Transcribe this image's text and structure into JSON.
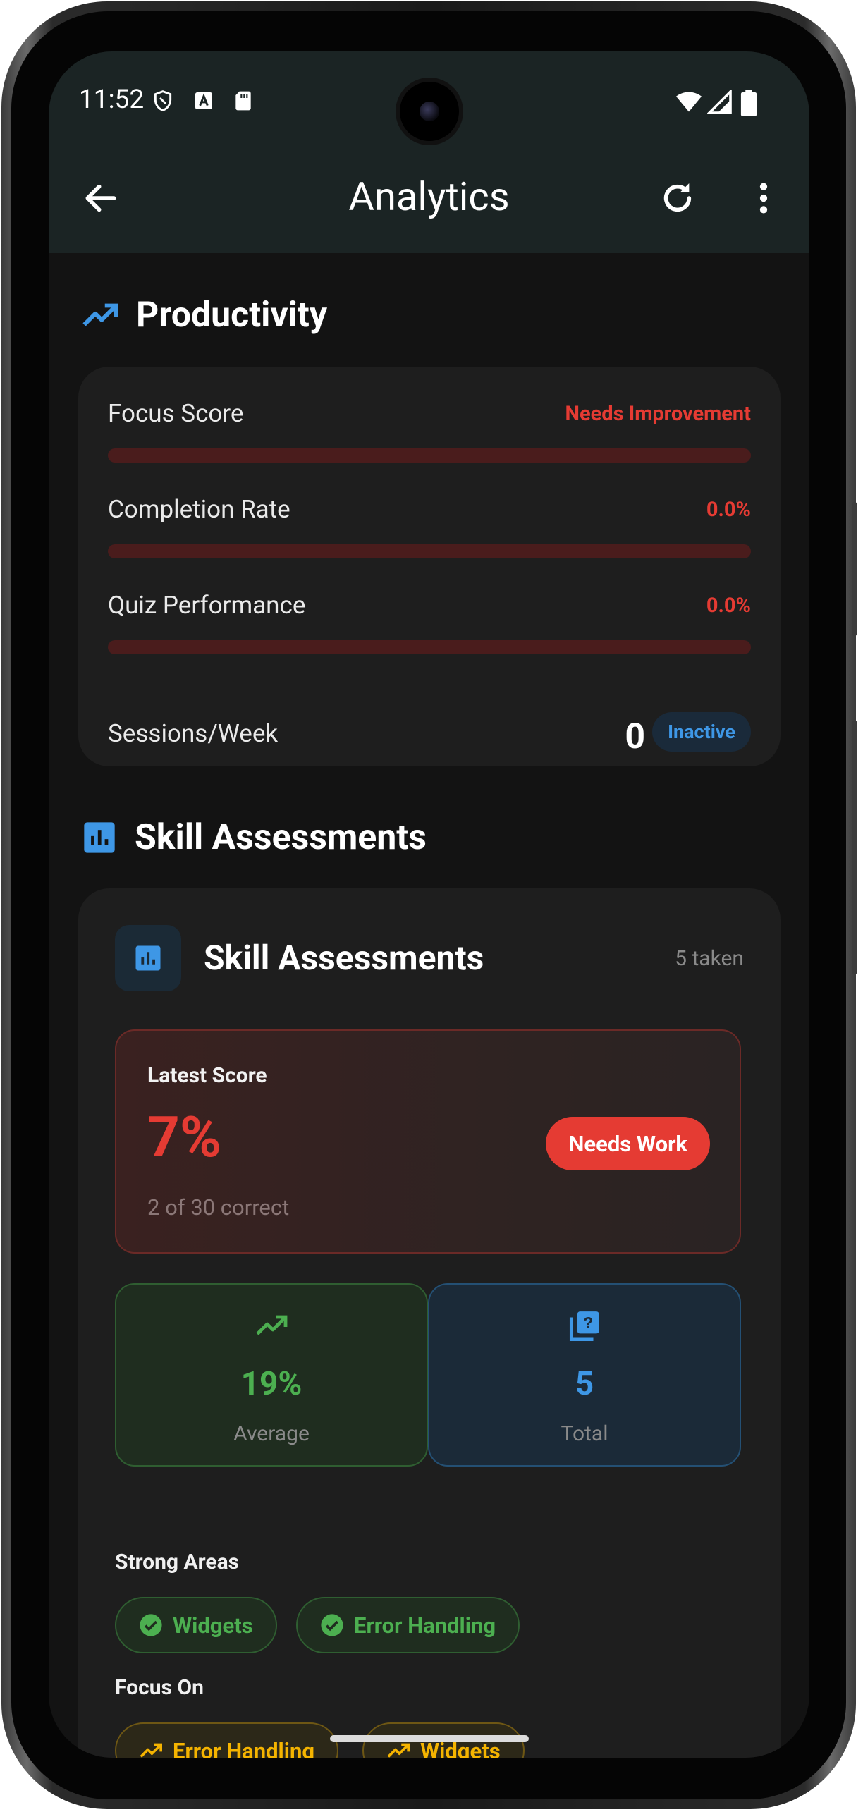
{
  "status_bar": {
    "time": "11:52"
  },
  "app_bar": {
    "title": "Analytics"
  },
  "productivity": {
    "heading": "Productivity",
    "focus_score": {
      "label": "Focus Score",
      "value": "Needs Improvement",
      "progress": 0
    },
    "completion_rate": {
      "label": "Completion Rate",
      "value": "0.0%",
      "progress": 0
    },
    "quiz_performance": {
      "label": "Quiz Performance",
      "value": "0.0%",
      "progress": 0
    },
    "sessions": {
      "label": "Sessions/Week",
      "value": "0",
      "badge": "Inactive"
    }
  },
  "skills_section": {
    "heading": "Skill Assessments"
  },
  "skills_card": {
    "title": "Skill Assessments",
    "count": "5 taken",
    "latest": {
      "label": "Latest Score",
      "score": "7%",
      "detail": "2 of 30 correct",
      "badge": "Needs Work"
    },
    "average": {
      "value": "19%",
      "label": "Average"
    },
    "total": {
      "value": "5",
      "label": "Total"
    },
    "strong_areas": {
      "label": "Strong Areas",
      "items": [
        "Widgets",
        "Error Handling"
      ]
    },
    "focus_on": {
      "label": "Focus On",
      "items": [
        "Error Handling",
        "Widgets"
      ]
    }
  },
  "colors": {
    "accent_red": "#e53b33",
    "accent_green": "#4caf50",
    "accent_blue": "#3e97e6",
    "accent_amber": "#f5b400",
    "app_bar_bg": "#1b2424",
    "screen_bg": "#131313",
    "card_bg": "#1e1e1e"
  }
}
